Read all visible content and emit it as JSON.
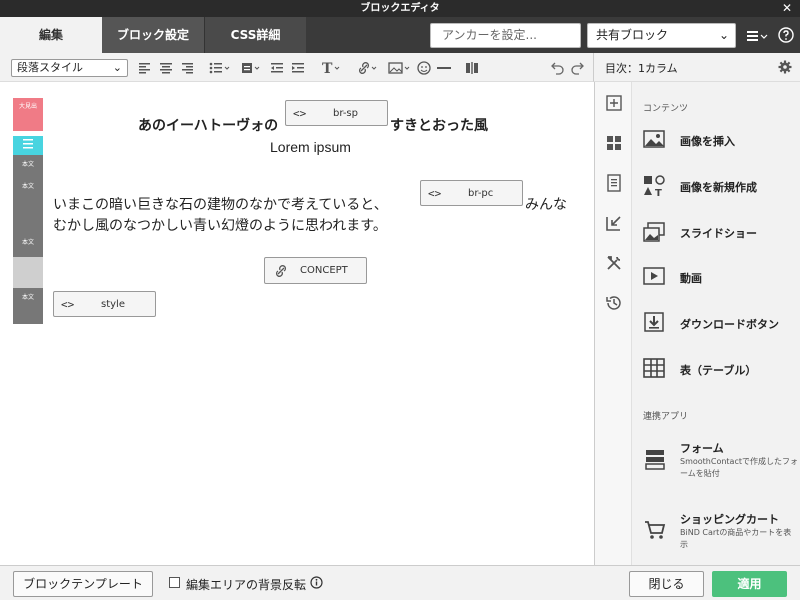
{
  "window": {
    "title": "ブロックエディタ",
    "close": "✕"
  },
  "tabs": [
    {
      "label": "編集"
    },
    {
      "label": "ブロック設定"
    },
    {
      "label": "CSS詳細"
    }
  ],
  "anchor": {
    "placeholder": "アンカーを設定..."
  },
  "shared_block": {
    "value": "共有ブロック"
  },
  "toolbar": {
    "paragraph_style": "段落スタイル"
  },
  "right_header": {
    "label": "目次：1カラム"
  },
  "left_blocks": [
    {
      "label": "大見出",
      "color": "#f07b86"
    },
    {
      "label": "本文",
      "color": "#777777"
    },
    {
      "label": "本文",
      "color": "#777777"
    },
    {
      "label": "本文",
      "color": "#777777"
    },
    {
      "label": "本文",
      "color": "#777777"
    }
  ],
  "editor": {
    "heading_part1": "あのイーハトーヴォの",
    "tag_br_sp": "br-sp",
    "heading_part2": "すきとおった風",
    "subheading": "Lorem ipsum",
    "para_line1": "いまこの暗い巨きな石の建物のなかで考えていると、",
    "tag_br_pc": "br-pc",
    "para_line1_end": "みんな",
    "para_line2": "むかし風のなつかしい青い幻燈のように思われます。",
    "link_concept": "CONCEPT",
    "tag_style": "style"
  },
  "panel": {
    "contents_title": "コンテンツ",
    "items": [
      {
        "label": "画像を挿入",
        "icon": "image-icon"
      },
      {
        "label": "画像を新規作成",
        "icon": "new-image-icon"
      },
      {
        "label": "スライドショー",
        "icon": "slideshow-icon"
      },
      {
        "label": "動画",
        "icon": "video-icon"
      },
      {
        "label": "ダウンロードボタン",
        "icon": "download-icon"
      },
      {
        "label": "表（テーブル）",
        "icon": "table-icon"
      }
    ],
    "apps_title": "連携アプリ",
    "apps": [
      {
        "label": "フォーム",
        "desc": "SmoothContactで作成したフォームを貼付"
      },
      {
        "label": "ショッピングカート",
        "desc": "BiND Cartの商品やカートを表示"
      }
    ]
  },
  "footer": {
    "template_button": "ブロックテンプレート",
    "invert_label": "編集エリアの背景反転",
    "close_button": "閉じる",
    "apply_button": "適用"
  },
  "colors": {
    "apply": "#4cc17d",
    "heading_block": "#f07b86",
    "list_block": "#48d4e0"
  }
}
